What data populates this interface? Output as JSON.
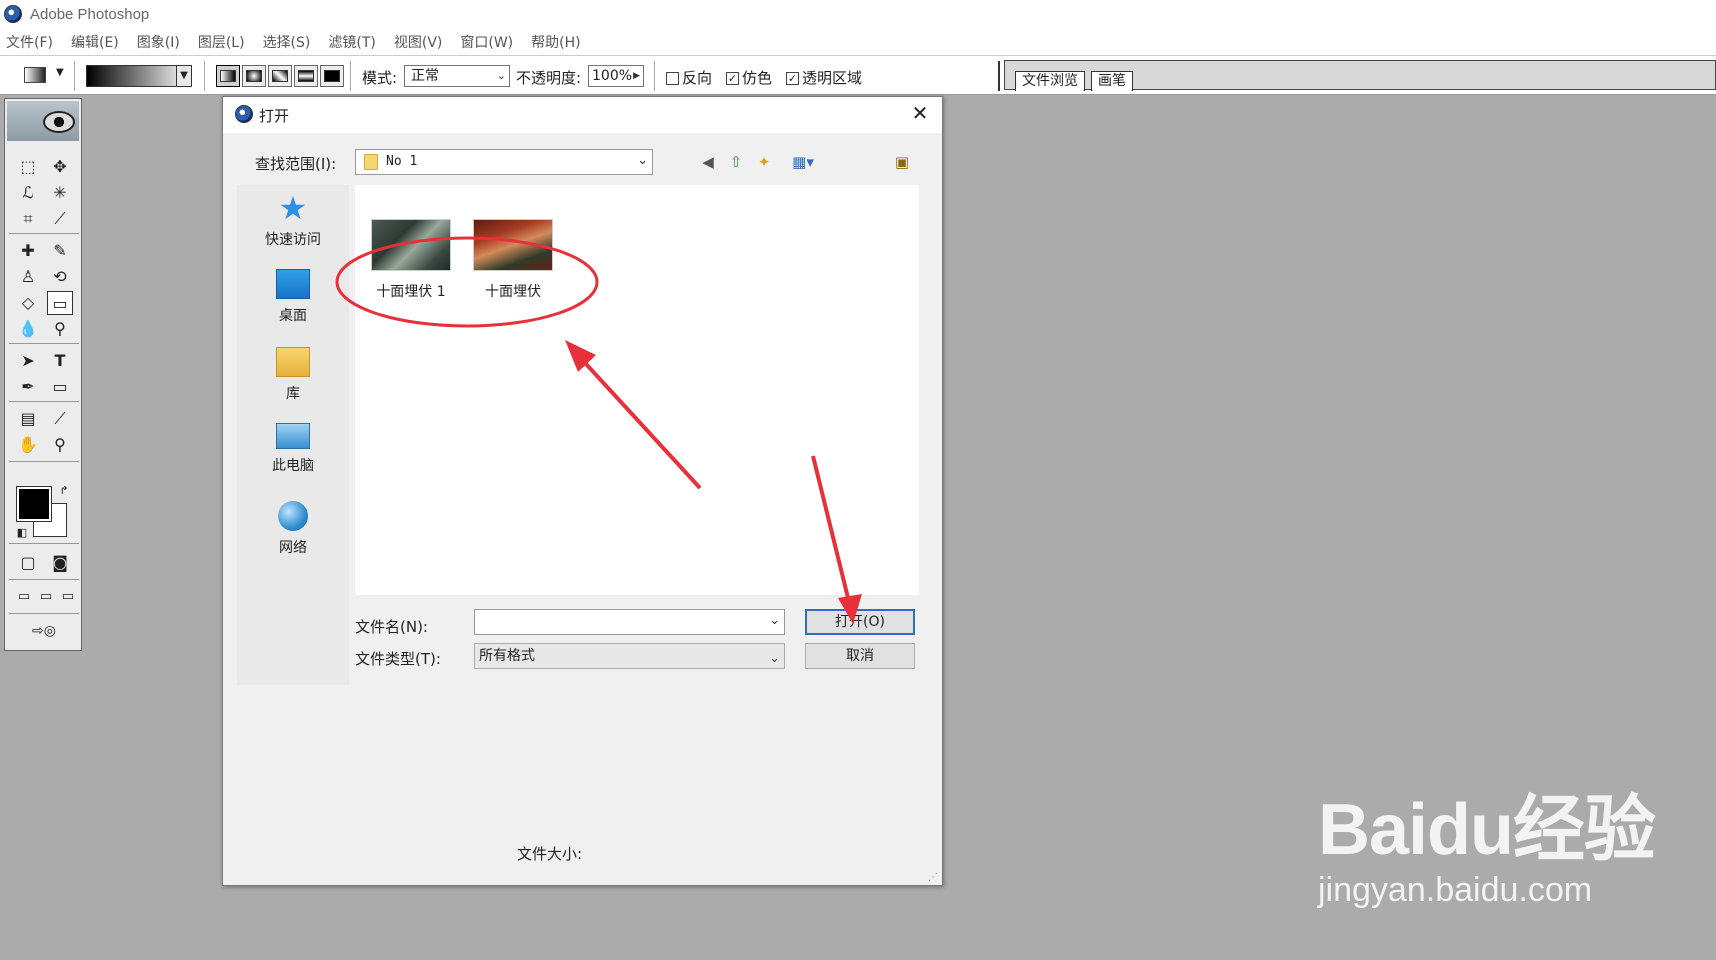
{
  "app": {
    "title": "Adobe Photoshop"
  },
  "menu": [
    "文件(F)",
    "编辑(E)",
    "图象(I)",
    "图层(L)",
    "选择(S)",
    "滤镜(T)",
    "视图(V)",
    "窗口(W)",
    "帮助(H)"
  ],
  "options": {
    "mode_label": "模式:",
    "mode_value": "正常",
    "opacity_label": "不透明度:",
    "opacity_value": "100%",
    "reverse_label": "反向",
    "reverse_checked": false,
    "dither_label": "仿色",
    "dither_checked": true,
    "transparency_label": "透明区域",
    "transparency_checked": true
  },
  "palette_tabs": [
    "文件浏览",
    "画笔"
  ],
  "dialog": {
    "title": "打开",
    "lookin_label": "查找范围(I):",
    "lookin_value": "No 1",
    "places": [
      {
        "label": "快速访问",
        "icon": "star-icon"
      },
      {
        "label": "桌面",
        "icon": "desktop-icon"
      },
      {
        "label": "库",
        "icon": "library-icon"
      },
      {
        "label": "此电脑",
        "icon": "computer-icon"
      },
      {
        "label": "网络",
        "icon": "network-icon"
      }
    ],
    "files": [
      {
        "name": "十面埋伏 1"
      },
      {
        "name": "十面埋伏"
      }
    ],
    "filename_label": "文件名(N):",
    "filename_value": "",
    "filetype_label": "文件类型(T):",
    "filetype_value": "所有格式",
    "open_button": "打开(O)",
    "cancel_button": "取消",
    "filesize_label": "文件大小:"
  },
  "watermark": {
    "main": "Baidu经验",
    "sub": "jingyan.baidu.com"
  },
  "colors": {
    "annotation_red": "#e8303a",
    "default_button_border": "#2f6fb8",
    "workspace": "#ababab"
  }
}
